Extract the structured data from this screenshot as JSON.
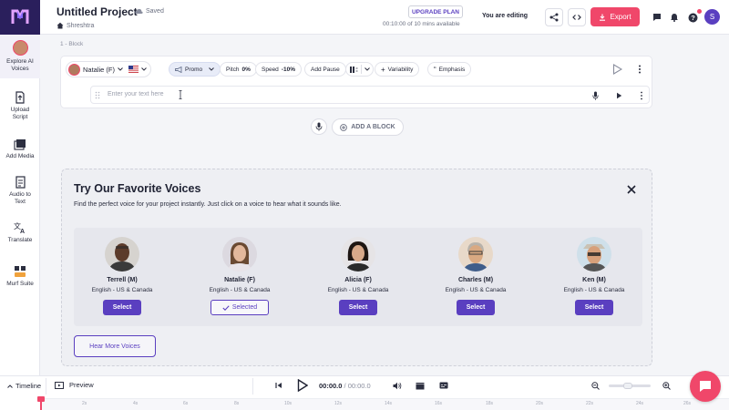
{
  "header": {
    "project_title": "Untitled Project",
    "saved_label": "Saved",
    "owner": "Shreshtra",
    "upgrade_label": "UPGRADE PLAN",
    "usage_text": "00:10:00 of 10 mins available",
    "editing_label": "You are editing",
    "export_label": "Export",
    "user_initial": "S",
    "accent_color": "#f0476a",
    "brand_color": "#5a3fc0"
  },
  "sidebar": {
    "items": [
      {
        "label_line1": "Explore AI",
        "label_line2": "Voices"
      },
      {
        "label_line1": "Upload",
        "label_line2": "Script"
      },
      {
        "label_line1": "Add Media",
        "label_line2": ""
      },
      {
        "label_line1": "Audio to",
        "label_line2": "Text"
      },
      {
        "label_line1": "Translate",
        "label_line2": ""
      },
      {
        "label_line1": "Murf Suite",
        "label_line2": ""
      }
    ]
  },
  "block": {
    "label": "1 - Block",
    "voice_name": "Natalie (F)",
    "style": "Promo",
    "pitch_label": "Pitch",
    "pitch_value": "0%",
    "speed_label": "Speed",
    "speed_value": "-10%",
    "add_pause": "Add Pause",
    "variability": "Variability",
    "emphasis": "Emphasis",
    "text_placeholder": "Enter your text here",
    "add_block_label": "ADD A BLOCK"
  },
  "voices_panel": {
    "title": "Try Our Favorite Voices",
    "description": "Find the perfect voice for your project instantly. Just click on a voice to hear what it sounds like.",
    "select_label": "Select",
    "selected_label": "Selected",
    "hear_more_label": "Hear More Voices",
    "voices": [
      {
        "name": "Terrell (M)",
        "lang": "English - US & Canada",
        "selected": false
      },
      {
        "name": "Natalie (F)",
        "lang": "English - US & Canada",
        "selected": true
      },
      {
        "name": "Alicia (F)",
        "lang": "English - US & Canada",
        "selected": false
      },
      {
        "name": "Charles (M)",
        "lang": "English - US & Canada",
        "selected": false
      },
      {
        "name": "Ken (M)",
        "lang": "English - US & Canada",
        "selected": false
      }
    ]
  },
  "timeline": {
    "label": "Timeline",
    "preview_label": "Preview",
    "current_time": "00:00.0",
    "total_time": "/ 00:00.0",
    "ticks": [
      "2s",
      "4s",
      "6s",
      "8s",
      "10s",
      "12s",
      "14s",
      "16s",
      "18s",
      "20s",
      "22s",
      "24s",
      "26s"
    ]
  }
}
